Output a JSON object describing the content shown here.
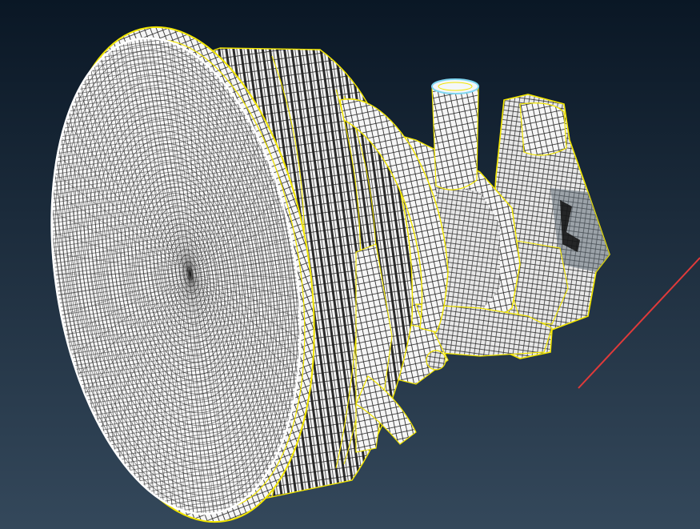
{
  "viewport": {
    "background_top": "#0a1725",
    "background_bottom": "#34485b",
    "object": "meshed-turbofan-engine-model"
  },
  "colors": {
    "mesh_fill": "#fbfbfb",
    "mesh_line": "#1c1c1c",
    "feature_edge": "#f2e600",
    "shadow": "#6d7780",
    "inlet_fill": "#f4f7f9",
    "pipe_opening": "#7fd6f0",
    "axis_line": "#e03a3a"
  },
  "axis_indicator": {
    "color": "#e03a3a"
  }
}
